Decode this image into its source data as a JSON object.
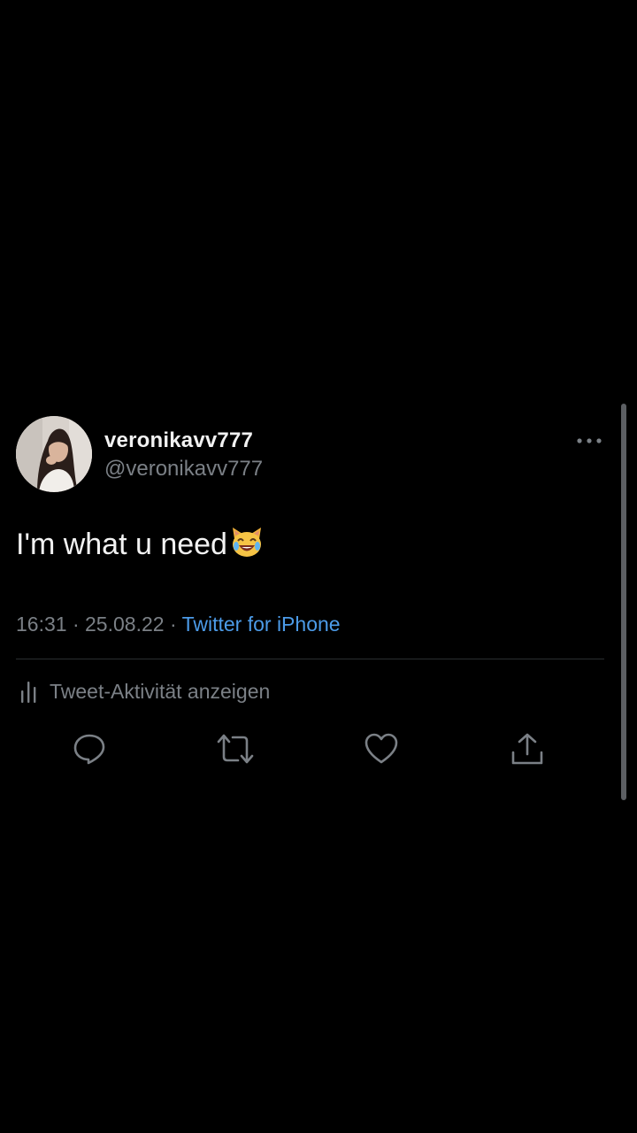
{
  "user": {
    "display_name": "veronikavv777",
    "handle": "@veronikavv777"
  },
  "tweet": {
    "text": "I'm what u need",
    "emoji": "cat-with-tears-of-joy-icon",
    "time": "16:31",
    "separator": "·",
    "date": "25.08.22",
    "source": "Twitter for iPhone"
  },
  "activity": {
    "label": "Tweet-Aktivität anzeigen",
    "icon": "bar-chart-icon"
  },
  "actions": [
    {
      "name": "reply",
      "icon": "reply-icon"
    },
    {
      "name": "retweet",
      "icon": "retweet-icon"
    },
    {
      "name": "like",
      "icon": "heart-icon"
    },
    {
      "name": "share",
      "icon": "share-icon"
    }
  ],
  "colors": {
    "background": "#000000",
    "primary_text": "#f2f2f2",
    "secondary_text": "#7b8086",
    "link": "#4c9be8",
    "divider": "#2b2e31",
    "icon": "#7b8086"
  }
}
